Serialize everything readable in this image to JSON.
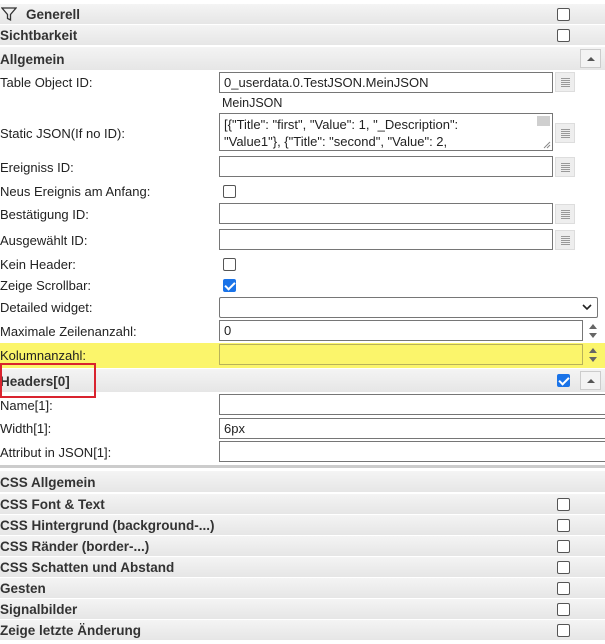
{
  "sections": {
    "generell": "Generell",
    "sichtbarkeit": "Sichtbarkeit",
    "allgemein": "Allgemein",
    "headers": "Headers[0]",
    "css_allgemein": "CSS Allgemein",
    "css_font": "CSS Font & Text",
    "css_bg": "CSS Hintergrund (background-...)",
    "css_border": "CSS Ränder (border-...)",
    "css_shadow": "CSS Schatten und Abstand",
    "gesten": "Gesten",
    "signalbilder": "Signalbilder",
    "letzte_aenderung": "Zeige letzte Änderung"
  },
  "fields": {
    "table_object_id": {
      "label": "Table Object ID:",
      "value": "0_userdata.0.TestJSON.MeinJSON",
      "hint": "MeinJSON"
    },
    "static_json": {
      "label": "Static JSON(If no ID):",
      "line1": "[{\"Title\": \"first\", \"Value\": 1, \"_Description\":",
      "line2": "\"Value1\"}, {\"Title\": \"second\", \"Value\": 2,"
    },
    "ereigniss_id": {
      "label": "Ereigniss ID:",
      "value": ""
    },
    "neues_ereignis": {
      "label": "Neus Ereignis am Anfang:"
    },
    "bestaetigung_id": {
      "label": "Bestätigung ID:",
      "value": ""
    },
    "ausgewaehlt_id": {
      "label": "Ausgewählt ID:",
      "value": ""
    },
    "kein_header": {
      "label": "Kein Header:"
    },
    "zeige_scrollbar": {
      "label": "Zeige Scrollbar:"
    },
    "detailed_widget": {
      "label": "Detailed widget:",
      "value": ""
    },
    "max_zeilen": {
      "label": "Maximale Zeilenanzahl:",
      "value": "0"
    },
    "kolumnanzahl": {
      "label": "Kolumnanzahl:",
      "value": ""
    },
    "name1": {
      "label": "Name[1]:",
      "value": ""
    },
    "width1": {
      "label": "Width[1]:",
      "value": "6px"
    },
    "attribut1": {
      "label": "Attribut in JSON[1]:",
      "value": ""
    }
  },
  "colors": {
    "highlight": "#fbf56b",
    "annotation": "#d9232e",
    "checkbox_on": "#1a73e8"
  }
}
